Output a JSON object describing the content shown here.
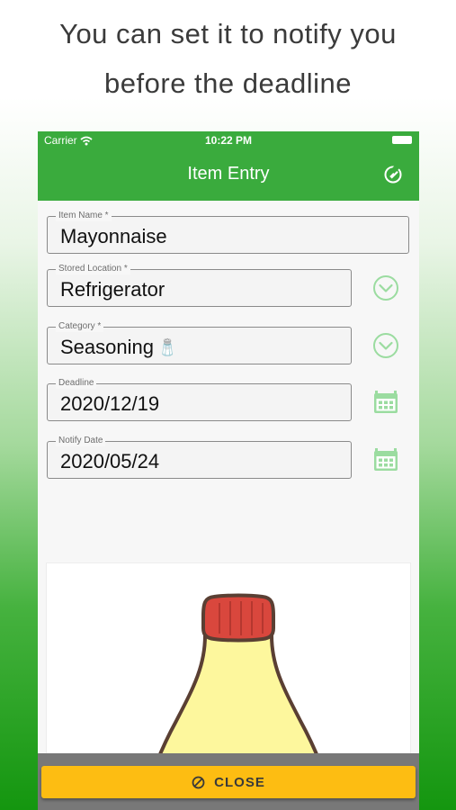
{
  "promo": {
    "line1": "You can set it to notify you",
    "line2": "before the deadline"
  },
  "status_bar": {
    "carrier": "Carrier",
    "time": "10:22 PM",
    "wifi_icon": "wifi-icon",
    "battery_icon": "battery-icon"
  },
  "nav": {
    "title": "Item Entry",
    "edit_icon": "edit-icon"
  },
  "form": {
    "item_name": {
      "label": "Item Name *",
      "value": "Mayonnaise"
    },
    "stored_location": {
      "label": "Stored Location *",
      "value": "Refrigerator",
      "icon": "chevron-down-circle-icon"
    },
    "category": {
      "label": "Category *",
      "value": "Seasoning",
      "emoji": "🧂",
      "icon": "chevron-down-circle-icon"
    },
    "deadline": {
      "label": "Deadline",
      "value": "2020/12/19",
      "icon": "calendar-icon"
    },
    "notify_date": {
      "label": "Notify Date",
      "value": "2020/05/24",
      "icon": "calendar-icon"
    }
  },
  "image": {
    "subject": "mayonnaise-bottle-illustration"
  },
  "footer": {
    "close_label": "CLOSE",
    "close_icon": "cancel-icon"
  },
  "colors": {
    "green": "#3aab3d",
    "accent_icon": "#9bdca0",
    "button_yellow": "#fdbd12"
  }
}
